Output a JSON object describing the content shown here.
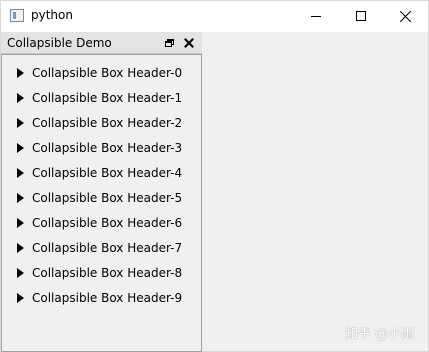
{
  "window": {
    "title": "python",
    "app_icon": "python-window-icon",
    "controls": {
      "minimize_icon": "minimize-icon",
      "maximize_icon": "maximize-icon",
      "close_icon": "close-icon"
    }
  },
  "dock": {
    "title": "Collapsible Demo",
    "float_icon": "float-icon",
    "close_icon": "close-icon",
    "items": [
      {
        "label": "Collapsible Box Header-0",
        "icon": "arrow-right-icon"
      },
      {
        "label": "Collapsible Box Header-1",
        "icon": "arrow-right-icon"
      },
      {
        "label": "Collapsible Box Header-2",
        "icon": "arrow-right-icon"
      },
      {
        "label": "Collapsible Box Header-3",
        "icon": "arrow-right-icon"
      },
      {
        "label": "Collapsible Box Header-4",
        "icon": "arrow-right-icon"
      },
      {
        "label": "Collapsible Box Header-5",
        "icon": "arrow-right-icon"
      },
      {
        "label": "Collapsible Box Header-6",
        "icon": "arrow-right-icon"
      },
      {
        "label": "Collapsible Box Header-7",
        "icon": "arrow-right-icon"
      },
      {
        "label": "Collapsible Box Header-8",
        "icon": "arrow-right-icon"
      },
      {
        "label": "Collapsible Box Header-9",
        "icon": "arrow-right-icon"
      }
    ]
  },
  "watermark": "知乎 @小雨",
  "colors": {
    "window_background": "#f0f0f0",
    "titlebar_background": "#ffffff",
    "dock_titlebar_background": "#e3e3e3",
    "dock_border": "#a0a0a0"
  }
}
